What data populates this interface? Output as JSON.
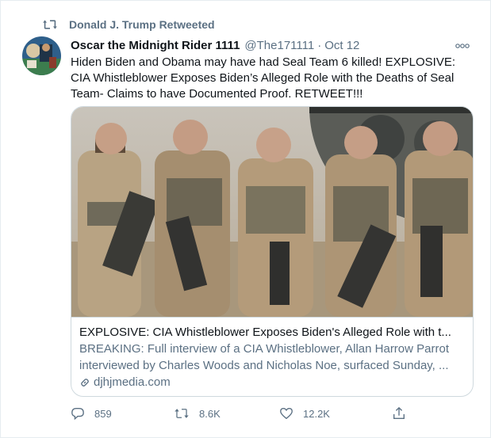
{
  "retweet": {
    "icon": "retweet-icon",
    "label": "Donald J. Trump Retweeted"
  },
  "tweet": {
    "display_name": "Oscar the Midnight Rider 1111",
    "handle": "@The171111",
    "separator": "·",
    "time": "Oct 12",
    "text": "Hiden Biden and Obama may have had Seal Team 6 killed! EXPLOSIVE: CIA Whistleblower Exposes Biden’s Alleged Role with the Deaths of Seal Team- Claims to have Documented Proof. RETWEET!!!"
  },
  "card": {
    "title": "EXPLOSIVE: CIA Whistleblower Exposes Biden's Alleged Role with t...",
    "desc_line1": "BREAKING: Full interview of a CIA Whistleblower, Allan Harrow Parrot",
    "desc_line2": "interviewed by Charles Woods and Nicholas Noe, surfaced Sunday, ...",
    "domain": "djhjmedia.com"
  },
  "actions": {
    "reply_count": "859",
    "retweet_count": "8.6K",
    "like_count": "12.2K"
  },
  "colors": {
    "muted": "#5b7083",
    "text": "#0f1419",
    "border": "#cfd9de"
  }
}
